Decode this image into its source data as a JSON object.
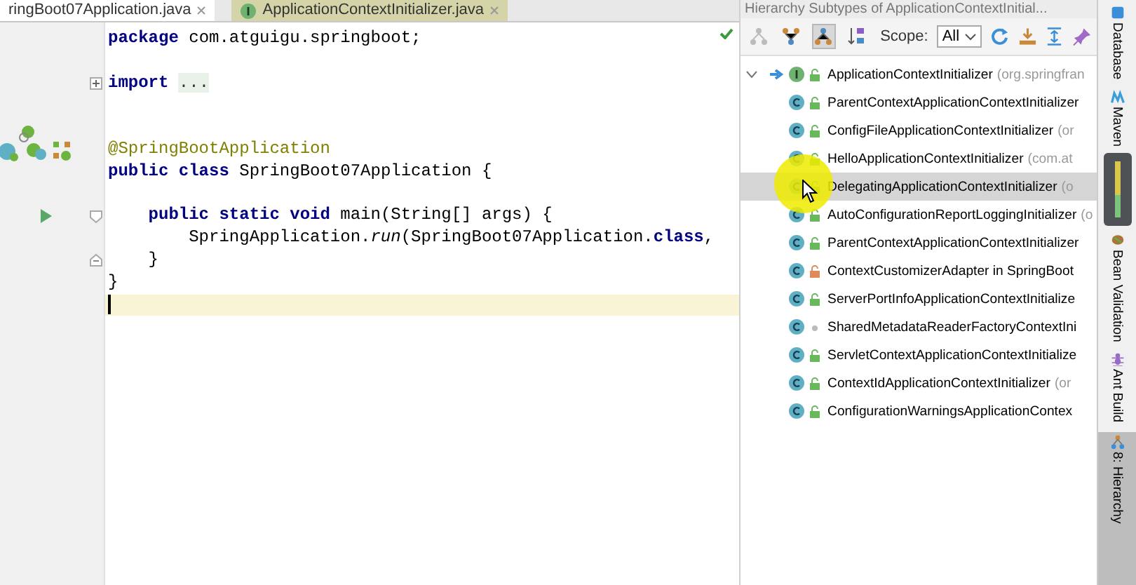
{
  "editor": {
    "tabs": [
      {
        "label": "ringBoot07Application.java",
        "kind": "class",
        "selected": true
      },
      {
        "label": "ApplicationContextInitializer.java",
        "kind": "interface",
        "selected": false
      }
    ],
    "lines": [
      {
        "current": false,
        "segments": [
          {
            "text": "package",
            "kind": "keyword"
          },
          {
            "text": " com.atguigu.springboot;",
            "kind": "plain"
          }
        ]
      },
      {
        "current": false
      },
      {
        "current": false,
        "fold": {
          "kind": "collapsed"
        },
        "segments": [
          {
            "text": "import ",
            "kind": "keyword"
          },
          {
            "text": "...",
            "kind": "folded"
          }
        ]
      },
      {
        "current": false
      },
      {
        "current": false
      },
      {
        "current": false,
        "gutter": {
          "kind": "spring"
        },
        "segments": [
          {
            "text": "@SpringBootApplication",
            "kind": "annotation"
          }
        ]
      },
      {
        "current": false,
        "segments": [
          {
            "text": "public class",
            "kind": "keyword"
          },
          {
            "text": " SpringBoot07Application {",
            "kind": "plain"
          }
        ]
      },
      {
        "current": false
      },
      {
        "current": false,
        "gutter": {
          "kind": "run"
        },
        "fold": {
          "kind": "start"
        },
        "segments": [
          {
            "text": "    public static void",
            "kind": "keyword"
          },
          {
            "text": " main(String[] args) {",
            "kind": "plain"
          }
        ]
      },
      {
        "current": false,
        "segments": [
          {
            "text": "        SpringApplication.",
            "kind": "plain"
          },
          {
            "text": "run",
            "kind": "call"
          },
          {
            "text": "(SpringBoot07Application.",
            "kind": "plain"
          },
          {
            "text": "class",
            "kind": "keyword"
          },
          {
            "text": ",",
            "kind": "plain"
          }
        ]
      },
      {
        "current": false,
        "fold": {
          "kind": "end"
        },
        "segments": [
          {
            "text": "    }",
            "kind": "plain"
          }
        ]
      },
      {
        "current": false,
        "segments": [
          {
            "text": "}",
            "kind": "plain"
          }
        ]
      },
      {
        "current": true
      }
    ]
  },
  "hierarchy": {
    "title": "Hierarchy Subtypes of ApplicationContextInitial...",
    "toolbar": [
      {
        "kind": "type-hierarchy",
        "selected": false
      },
      {
        "kind": "supertypes",
        "selected": false
      },
      {
        "kind": "subtypes",
        "selected": true
      },
      {
        "kind": "sort",
        "selected": false
      }
    ],
    "scope": {
      "label": "Scope:",
      "value": "All"
    },
    "actions": [
      {
        "kind": "refresh"
      },
      {
        "kind": "export"
      },
      {
        "kind": "expand"
      },
      {
        "kind": "pin"
      }
    ],
    "tree": [
      {
        "name": "ApplicationContextInitializer",
        "suffix": "(org.springfran",
        "kind": "interface",
        "access": {
          "kind": "public"
        },
        "expanded": true,
        "selected": false,
        "children": [
          {
            "name": "ParentContextApplicationContextInitializer",
            "kind": "class",
            "access": {
              "kind": "public"
            },
            "selected": false
          },
          {
            "name": "ConfigFileApplicationContextInitializer",
            "suffix": "(or",
            "kind": "class",
            "access": {
              "kind": "public"
            },
            "selected": false
          },
          {
            "name": "HelloApplicationContextInitializer",
            "suffix": "(com.at",
            "kind": "class",
            "access": {
              "kind": "public"
            },
            "selected": false
          },
          {
            "name": "DelegatingApplicationContextInitializer",
            "suffix": "(o",
            "kind": "class",
            "access": {
              "kind": "public"
            },
            "selected": true
          },
          {
            "name": "AutoConfigurationReportLoggingInitializer",
            "suffix": "(o",
            "kind": "class",
            "access": {
              "kind": "public"
            },
            "selected": false
          },
          {
            "name": "ParentContextApplicationContextInitializer",
            "kind": "class",
            "access": {
              "kind": "public"
            },
            "selected": false
          },
          {
            "name": "ContextCustomizerAdapter in SpringBoot",
            "kind": "class",
            "access": {
              "kind": "private"
            },
            "selected": false
          },
          {
            "name": "ServerPortInfoApplicationContextInitialize",
            "kind": "class",
            "access": {
              "kind": "public"
            },
            "selected": false
          },
          {
            "name": "SharedMetadataReaderFactoryContextIni",
            "kind": "class",
            "access": {
              "kind": "package"
            },
            "selected": false
          },
          {
            "name": "ServletContextApplicationContextInitialize",
            "kind": "class",
            "access": {
              "kind": "public"
            },
            "selected": false
          },
          {
            "name": "ContextIdApplicationContextInitializer",
            "suffix": "(or",
            "kind": "class",
            "access": {
              "kind": "public"
            },
            "selected": false
          },
          {
            "name": "ConfigurationWarningsApplicationContex",
            "kind": "class",
            "access": {
              "kind": "public"
            },
            "selected": false
          }
        ]
      }
    ]
  },
  "tool_strip": [
    {
      "label": "Database",
      "kind": "database",
      "selected": false
    },
    {
      "label": "Maven",
      "kind": "maven",
      "selected": false
    },
    {
      "label": "Bean Validation",
      "kind": "bean",
      "selected": false
    },
    {
      "label": "Ant Build",
      "kind": "ant",
      "selected": false
    },
    {
      "label": "8: Hierarchy",
      "kind": "hierarchy",
      "selected": true
    }
  ]
}
